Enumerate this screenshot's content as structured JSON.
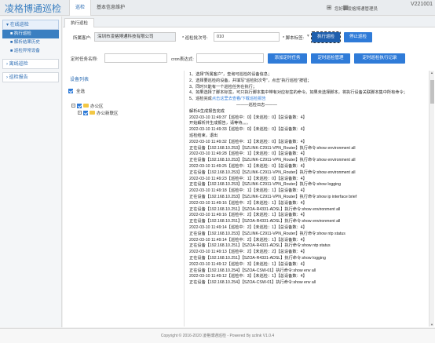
{
  "header": {
    "brand": "凌格博通巡检",
    "nav": [
      "巡检",
      "基本信息维护"
    ],
    "user": "您好，凌格博通管理员",
    "version": "V221001",
    "icons": [
      "grid-icon",
      "menu-grid-icon"
    ]
  },
  "sidebar": {
    "groups": [
      {
        "label": "在线巡检",
        "items": [
          "执行巡检",
          "解析结果历史",
          "巡检异常设备"
        ]
      },
      {
        "label": "离线巡检",
        "items": []
      },
      {
        "label": "巡检报告",
        "items": []
      }
    ],
    "active_item": "执行巡检"
  },
  "tab": {
    "label": "执行巡检"
  },
  "form": {
    "customer_label": "所属客户:",
    "customer_value": "深圳市凌格博通科技有限公司",
    "batch_label": "* 巡检批次号:",
    "batch_value": "010",
    "script_label": "* 脚本标签:",
    "exec_button": "执行巡检",
    "stop_button": "停止巡检",
    "task_label": "定时任务名称:",
    "cron_label": "cron表达式:",
    "add_task_button": "添加定时任务",
    "manage_task_button": "定时巡检管理",
    "record_button": "定时巡检执行记录"
  },
  "devices": {
    "title": "设备列表",
    "select_all": "全选",
    "tree": [
      {
        "label": "办公区",
        "level": 0
      },
      {
        "label": "办公新联区",
        "level": 1
      }
    ]
  },
  "log": {
    "instructions": [
      "1、选择\"所属客户\"，查询可巡检的设备信息；",
      "2、选择要巡检的设备，并填写\"巡检批次号\"，点击\"执行巡检\"按钮；",
      "3、同时只能有一个巡检任务在执行；",
      "4、如果选择了脚本标签，可只执行脚本集中带有对应标签的命令。如果未选择脚本，将执行设备关联脚本集中所有命令；"
    ],
    "done_prefix": "5、巡检完成",
    "done_link": "点击这里去查看/下载巡检报告",
    "divider": "———巡检日志———",
    "lines": [
      "解析&生成报告完成",
      "2022-03-10 11:49:37【巡检中：0】【未巡检：0】【总设备数：4】",
      "开始解析并生成报告，请等待。。。",
      "2022-03-10 11:49:33【巡检中：0】【未巡检：0】【总设备数：4】",
      "巡检结束，退出",
      "2022-03-10 11:49:32【巡检中：1】【未巡检：0】【总设备数：4】",
      "正在设备【192.168.10.253】【SZLINK-C2911-VPN_Router】执行命令:show environment all",
      "2022-03-10 11:49:28【巡检中：1】【未巡检：0】【总设备数：4】",
      "正在设备【192.168.10.253】【SZLINK-C2911-VPN_Router】执行命令:show environment all",
      "2022-03-10 11:49:25【巡检中：1】【未巡检：0】【总设备数：4】",
      "正在设备【192.168.10.253】【SZLINK-C2911-VPN_Router】执行命令:show environment all",
      "2022-03-10 11:49:23【巡检中：1】【未巡检：0】【总设备数：4】",
      "正在设备【192.168.10.253】【SZLINK-C2911-VPN_Router】执行命令:show logging",
      "2022-03-10 11:49:18【巡检中：1】【未巡检：1】【总设备数：4】",
      "正在设备【192.168.10.253】【SZLINK-C2911-VPN_Router】执行命令:show ip interface brief",
      "2022-03-10 11:49:16【巡检中：2】【未巡检：1】【总设备数：4】",
      "正在设备【192.168.10.251】【SZOA-R4331-ADSL】执行命令:show environment all",
      "2022-03-10 11:49:16【巡检中：2】【未巡检：1】【总设备数：4】",
      "正在设备【192.168.10.251】【SZOA-R4331-ADSL】执行命令:show environment all",
      "2022-03-10 11:49:14【巡检中：2】【未巡检：1】【总设备数：4】",
      "正在设备【192.168.10.253】【SZLINK-C2911-VPN_Router】执行命令:show ntp status",
      "2022-03-10 11:49:14【巡检中：2】【未巡检：1】【总设备数：4】",
      "正在设备【192.168.10.251】【SZOA-R4331-ADSL】执行命令:show ntp status",
      "2022-03-10 11:49:13【巡检中：2】【未巡检：2】【总设备数：4】",
      "正在设备【192.168.10.251】【SZOA-R4331-ADSL】执行命令:show logging",
      "2022-03-10 11:49:12【巡检中：3】【未巡检：1】【总设备数：4】",
      "正在设备【192.168.10.254】【SZOA-CSW-01】执行命令:show env all",
      "2022-03-10 11:49:12【巡检中：3】【未巡检：1】【总设备数：4】",
      "正在设备【192.168.10.254】【SZOA-CSW-01】执行命令:show env all"
    ]
  },
  "footer": "Copyright © 2016-2020 凌格博通巡检 - Powered By szlink V1.0.4"
}
